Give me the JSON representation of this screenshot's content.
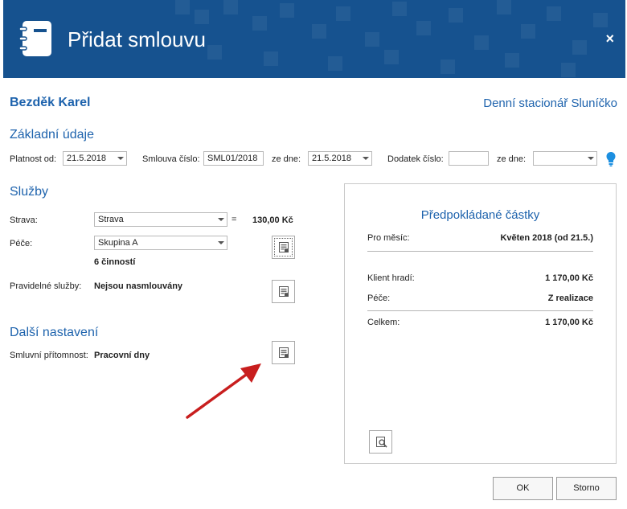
{
  "dialog": {
    "title": "Přidat smlouvu",
    "close_glyph": "×"
  },
  "client": {
    "name": "Bezděk Karel",
    "facility": "Denní stacionář Sluníčko"
  },
  "basic": {
    "heading": "Základní údaje",
    "valid_from_label": "Platnost od:",
    "valid_from_value": "21.5.2018",
    "contract_no_label": "Smlouva číslo:",
    "contract_no_value": "SML01/2018",
    "date_label": "ze dne:",
    "date_value": "21.5.2018",
    "amendment_label": "Dodatek číslo:",
    "amendment_value": "",
    "amendment_date_label": "ze dne:",
    "amendment_date_value": ""
  },
  "services": {
    "heading": "Služby",
    "food_label": "Strava:",
    "food_value": "Strava",
    "equals": "=",
    "food_price": "130,00 Kč",
    "care_label": "Péče:",
    "care_value": "Skupina A",
    "activities": "6 činností",
    "regular_label": "Pravidelné služby:",
    "regular_value": "Nejsou nasmlouvány"
  },
  "other": {
    "heading": "Další nastavení",
    "attendance_label": "Smluvní přítomnost:",
    "attendance_value": "Pracovní dny"
  },
  "summary": {
    "heading": "Předpokládané částky",
    "month_label": "Pro měsíc:",
    "month_value": "Květen 2018 (od 21.5.)",
    "client_pays_label": "Klient hradí:",
    "client_pays_value": "1 170,00 Kč",
    "care_label": "Péče:",
    "care_value": "Z realizace",
    "total_label": "Celkem:",
    "total_value": "1 170,00 Kč"
  },
  "footer": {
    "ok": "OK",
    "cancel": "Storno"
  },
  "colors": {
    "header": "#16528f",
    "accent": "#1e63ad",
    "hint_bulb": "#1c8fe0",
    "annotation_arrow": "#c81e1e"
  },
  "icons": [
    "notebook-icon",
    "close-icon",
    "lightbulb-icon",
    "list-edit-icon",
    "preview-search-icon",
    "arrow-annotation"
  ]
}
